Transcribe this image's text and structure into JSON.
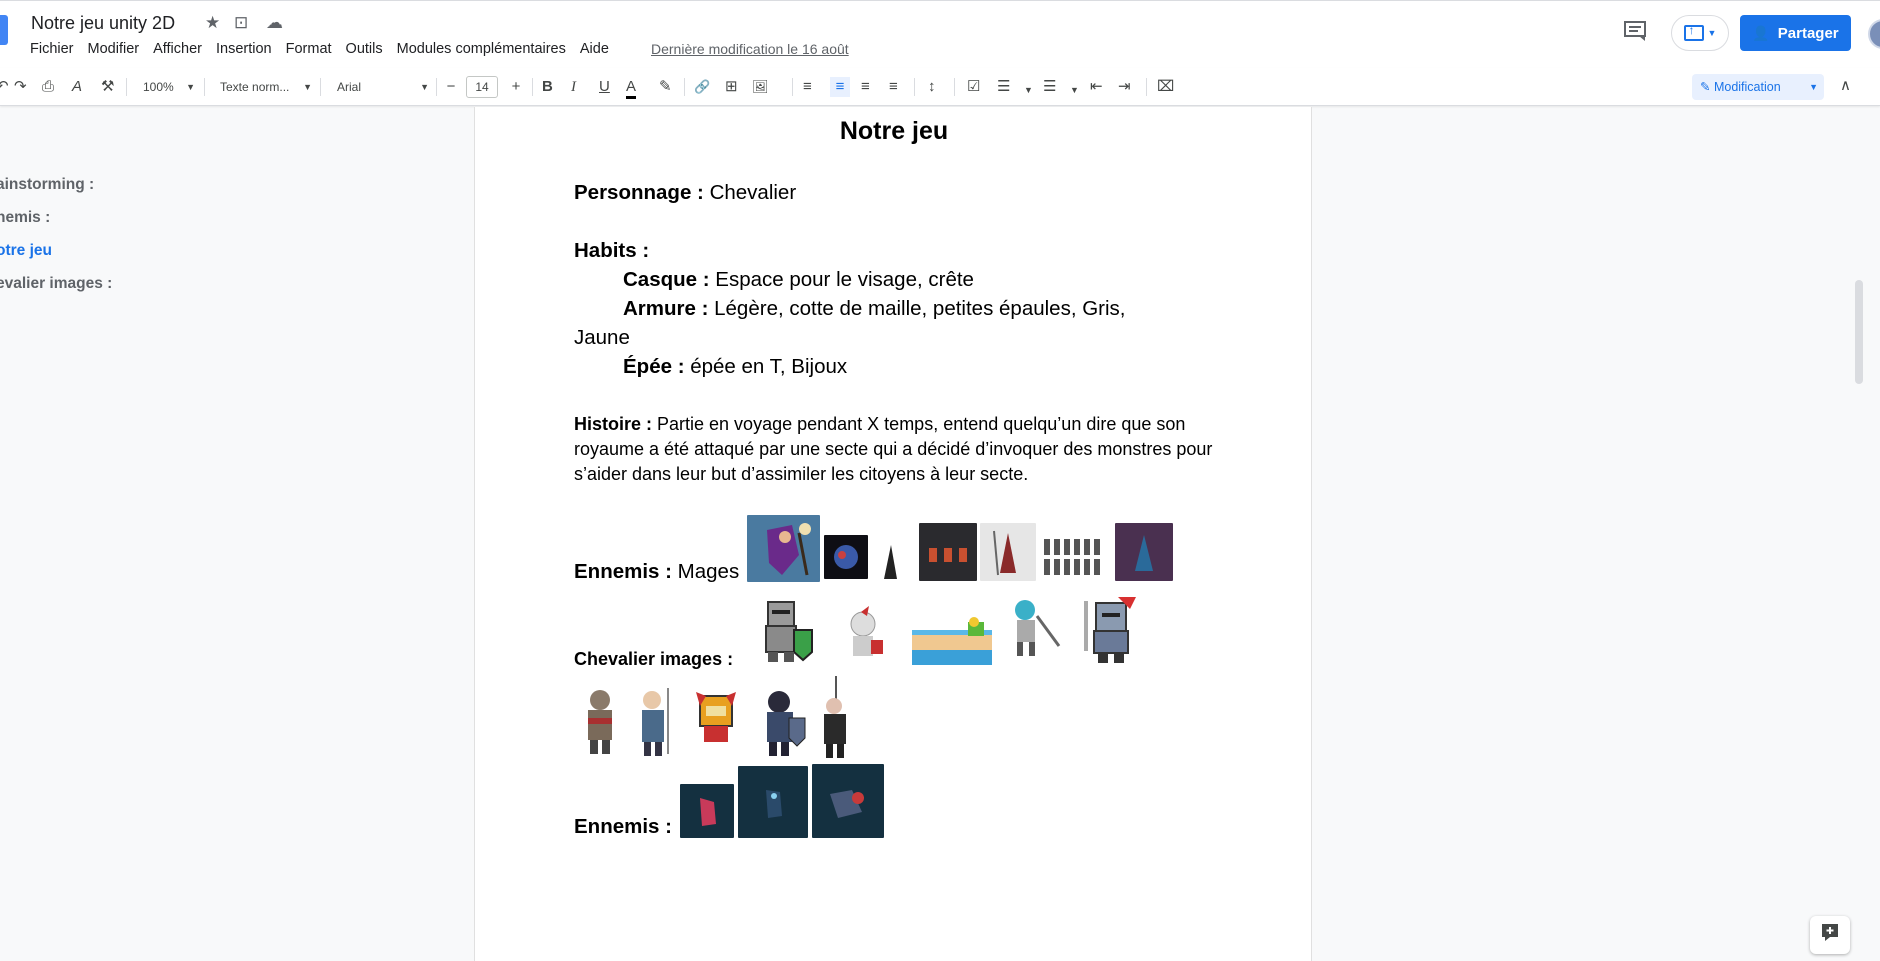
{
  "header": {
    "doc_title": "Notre jeu unity 2D",
    "star_icon": "★",
    "move_icon": "⊡",
    "cloud_icon": "☁",
    "menus": [
      "Fichier",
      "Modifier",
      "Afficher",
      "Insertion",
      "Format",
      "Outils",
      "Modules complémentaires",
      "Aide"
    ],
    "last_edit": "Dernière modification le 16 août",
    "share_label": "Partager",
    "share_icon": "👤"
  },
  "toolbar": {
    "undo": "↶",
    "redo": "↷",
    "print": "⎙",
    "spellcheck": "A",
    "paint_format": "⚒",
    "zoom": "100%",
    "style": "Texte norm...",
    "font": "Arial",
    "font_minus": "−",
    "font_size": "14",
    "font_plus": "+",
    "bold": "B",
    "italic": "I",
    "underline": "U",
    "text_color": "A",
    "highlight": "✎",
    "link": "🔗",
    "comment": "⊞",
    "image": "🖼",
    "align_left": "≡",
    "align_center": "≡",
    "align_right": "≡",
    "align_justify": "≡",
    "line_spacing": "↕",
    "checklist": "☑",
    "bullets": "☰",
    "numbered": "☰",
    "indent_less": "⇤",
    "indent_more": "⇥",
    "clear_format": "⌧",
    "mode": "Modification",
    "collapse": "∧"
  },
  "outline": [
    {
      "label": "ainstorming :",
      "active": false
    },
    {
      "label": "nemis :",
      "active": false
    },
    {
      "label": "otre jeu",
      "active": true
    },
    {
      "label": "evalier images :",
      "active": false
    }
  ],
  "document": {
    "heading": "Notre jeu",
    "personnage_label": "Personnage :",
    "personnage_value": " Chevalier",
    "habits_label": "Habits :",
    "casque_label": "Casque :",
    "casque_value": " Espace pour le visage, crête",
    "armure_label": "Armure :",
    "armure_value": " Légère, cotte de maille, petites épaules, Gris,",
    "armure_cont": "Jaune",
    "epee_label": "Épée :",
    "epee_value": " épée en T, Bijoux",
    "histoire_label": "Histoire :",
    "histoire_value": " Partie en voyage pendant X temps, entend quelqu’un dire que son royaume a été attaqué par une secte qui a décidé d’invoquer des monstres pour s’aider dans leur but d’assimiler les citoyens à leur secte.",
    "ennemis_label": "Ennemis :",
    "ennemis_value": " Mages",
    "chevalier_label": "Chevalier images :",
    "ennemis2_label": "Ennemis :"
  },
  "colors": {
    "accent": "#1a73e8",
    "mode_bg": "#e8f0fe"
  }
}
